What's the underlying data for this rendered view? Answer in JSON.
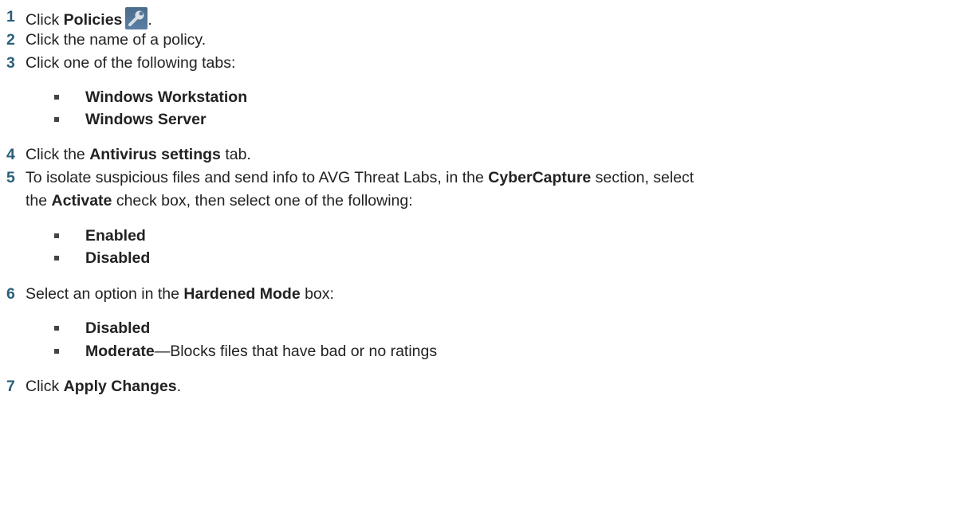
{
  "steps": [
    {
      "num": "1",
      "pre": "Click ",
      "bold": "Policies",
      "post": ".",
      "icon": "wrench-icon"
    },
    {
      "num": "2",
      "text": "Click the name of a policy."
    },
    {
      "num": "3",
      "text": "Click one of the following tabs:",
      "bullets": [
        "Windows Workstation",
        "Windows Server"
      ]
    },
    {
      "num": "4",
      "pre": "Click the ",
      "bold": "Antivirus settings",
      "post": " tab."
    },
    {
      "num": "5",
      "line1": {
        "pre": "To isolate suspicious files and send info to AVG Threat Labs, in the ",
        "bold": "CyberCapture",
        "post": " section, select"
      },
      "line2": {
        "pre": "the ",
        "bold": "Activate",
        "post": " check box, then select one of the following:"
      },
      "bullets": [
        "Enabled",
        "Disabled"
      ]
    },
    {
      "num": "6",
      "pre": "Select an option in the ",
      "bold": "Hardened Mode",
      "post": " box:",
      "bullets": [
        {
          "bold": "Disabled",
          "rest": ""
        },
        {
          "bold": "Moderate",
          "rest": "—Blocks files that have bad or no ratings"
        }
      ]
    },
    {
      "num": "7",
      "pre": "Click ",
      "bold": "Apply Changes",
      "post": "."
    }
  ]
}
